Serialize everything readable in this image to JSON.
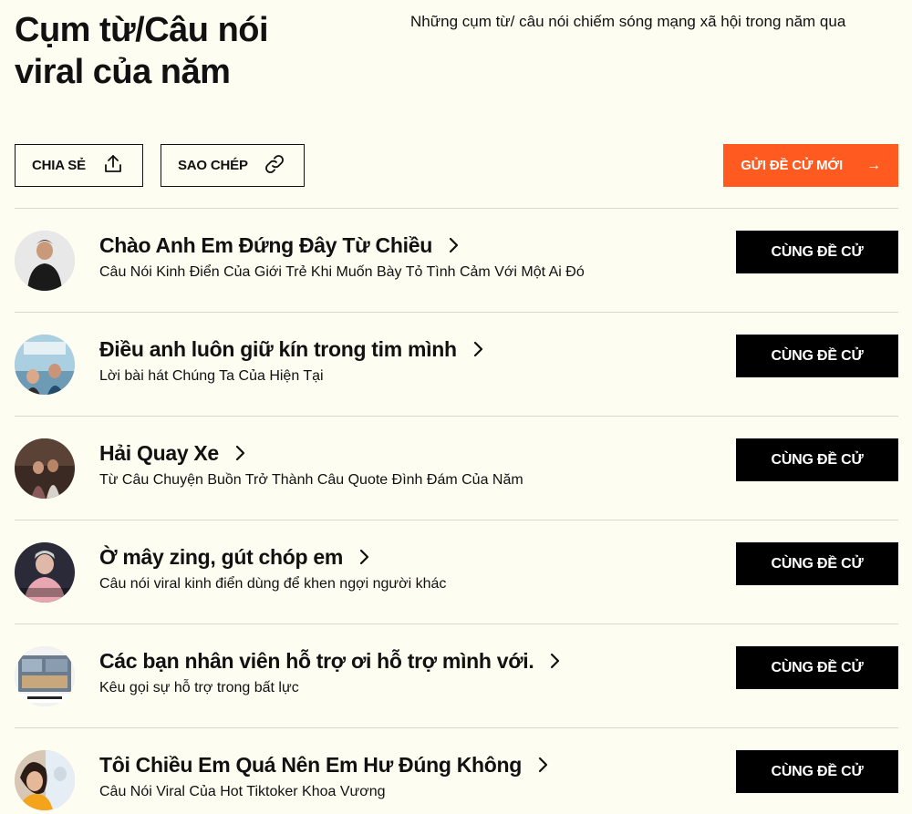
{
  "header": {
    "title": "Cụm từ/Câu nói viral của năm",
    "subtitle": "Những cụm từ/ câu nói chiếm sóng mạng xã hội trong năm qua"
  },
  "actions": {
    "share_label": "CHIA SẺ",
    "copy_label": "SAO CHÉP",
    "submit_label": "GỬI ĐỀ CỬ MỚI",
    "submit_color": "#ff5a1f"
  },
  "items": [
    {
      "title": "Chào Anh Em Đứng Đây Từ Chiều",
      "desc": "Câu Nói Kinh Điển Của Giới Trẻ Khi Muốn Bày Tỏ Tình Cảm Với Một Ai Đó",
      "vote_label": "CÙNG ĐỀ CỬ"
    },
    {
      "title": "Điều anh luôn giữ kín trong tim mình",
      "desc": "Lời bài hát Chúng Ta Của Hiện Tại",
      "vote_label": "CÙNG ĐỀ CỬ"
    },
    {
      "title": "Hải Quay Xe",
      "desc": "Từ Câu Chuyện Buồn Trở Thành Câu Quote Đình Đám Của Năm",
      "vote_label": "CÙNG ĐỀ CỬ"
    },
    {
      "title": "Ờ mây zing, gút chóp em",
      "desc": "Câu nói viral kinh điển dùng để khen ngợi người khác",
      "vote_label": "CÙNG ĐỀ CỬ"
    },
    {
      "title": "Các bạn nhân viên hỗ trợ ơi hỗ trợ mình với.",
      "desc": "Kêu gọi sự hỗ trợ trong bất lực",
      "vote_label": "CÙNG ĐỀ CỬ"
    },
    {
      "title": "Tôi Chiều Em Quá Nên Em Hư Đúng Không",
      "desc": "Câu Nói Viral Của Hot Tiktoker Khoa Vương",
      "vote_label": "CÙNG ĐỀ CỬ"
    }
  ]
}
